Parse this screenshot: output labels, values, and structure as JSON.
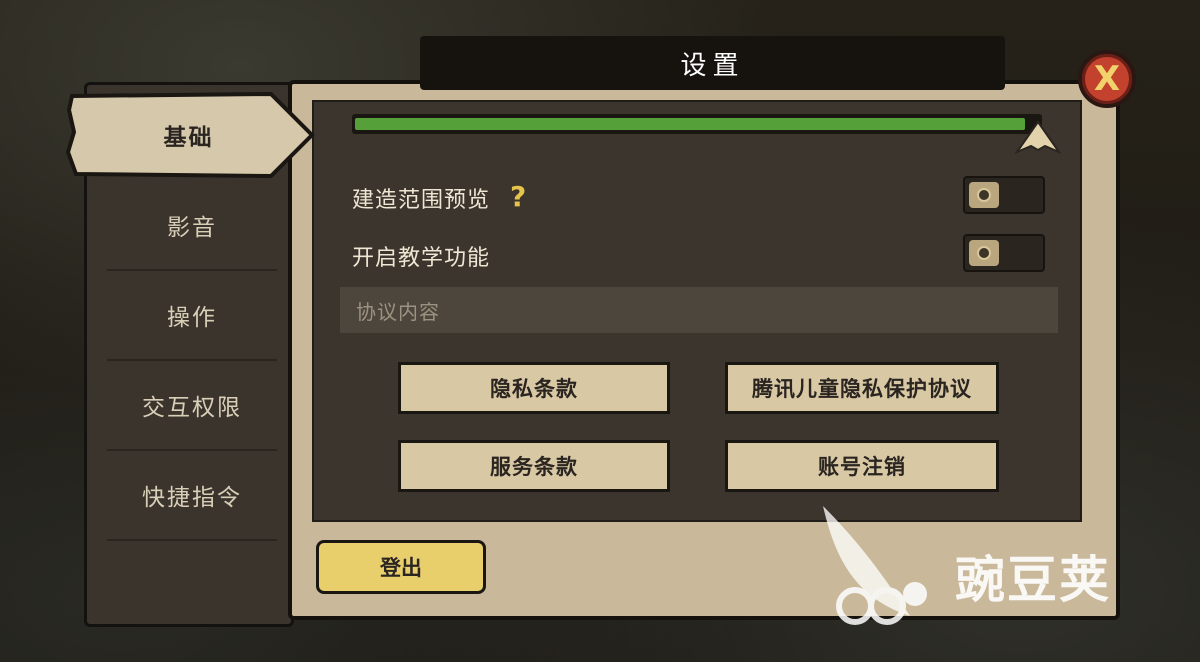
{
  "dialog": {
    "title": "设置",
    "close_label": "X"
  },
  "sidebar": {
    "items": [
      {
        "label": "基础",
        "active": true
      },
      {
        "label": "影音",
        "active": false
      },
      {
        "label": "操作",
        "active": false
      },
      {
        "label": "交互权限",
        "active": false
      },
      {
        "label": "快捷指令",
        "active": false
      }
    ]
  },
  "settings": {
    "slider": {
      "value_fraction": 0.98,
      "color": "#56a03a"
    },
    "build_preview": {
      "label": "建造范围预览",
      "help_icon": "?",
      "enabled": false
    },
    "tutorial": {
      "label": "开启教学功能",
      "enabled": false
    }
  },
  "agreement": {
    "section_label": "协议内容",
    "buttons": [
      "隐私条款",
      "腾讯儿童隐私保护协议",
      "服务条款",
      "账号注销"
    ]
  },
  "logout_label": "登出",
  "watermark": {
    "text": "豌豆荚",
    "icon": "wandoujia-logo"
  }
}
